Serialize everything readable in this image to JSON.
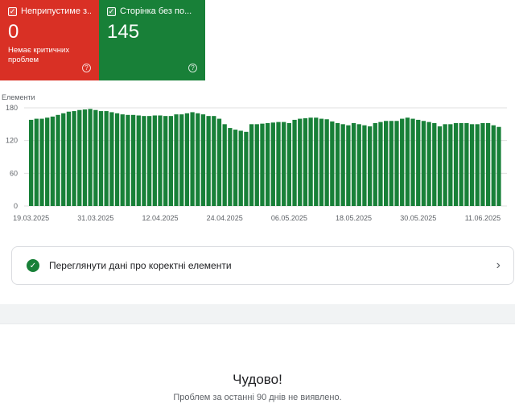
{
  "summary_cards": [
    {
      "label": "Неприпустиме з...",
      "count": "0",
      "subtitle": "Немає критичних проблем",
      "color": "#d93025"
    },
    {
      "label": "Сторінка без по...",
      "count": "145",
      "subtitle": "",
      "color": "#188038"
    }
  ],
  "chart_data": {
    "type": "bar",
    "ylabel": "Елементи",
    "ylim": [
      0,
      180
    ],
    "yticks": [
      0,
      60,
      120,
      180
    ],
    "x_tick_labels": [
      "19.03.2025",
      "31.03.2025",
      "12.04.2025",
      "24.04.2025",
      "06.05.2025",
      "18.05.2025",
      "30.05.2025",
      "11.06.2025"
    ],
    "start_date": "19.03.2025",
    "bar_color": "#188038",
    "grid": true,
    "values": [
      158,
      160,
      160,
      162,
      164,
      167,
      170,
      173,
      174,
      176,
      177,
      178,
      176,
      174,
      174,
      172,
      170,
      168,
      167,
      167,
      166,
      165,
      165,
      166,
      166,
      165,
      165,
      168,
      168,
      170,
      172,
      170,
      168,
      165,
      165,
      160,
      150,
      143,
      140,
      138,
      136,
      150,
      150,
      151,
      152,
      153,
      154,
      154,
      152,
      158,
      160,
      161,
      162,
      162,
      160,
      159,
      155,
      152,
      150,
      148,
      152,
      150,
      148,
      146,
      152,
      154,
      156,
      156,
      156,
      160,
      162,
      160,
      158,
      156,
      154,
      152,
      146,
      150,
      150,
      152,
      152,
      152,
      150,
      150,
      152,
      152,
      148,
      145
    ]
  },
  "details_tile": {
    "label": "Переглянути дані про коректні елементи"
  },
  "empty_state": {
    "title": "Чудово!",
    "message": "Проблем за останні 90 днів не виявлено."
  }
}
